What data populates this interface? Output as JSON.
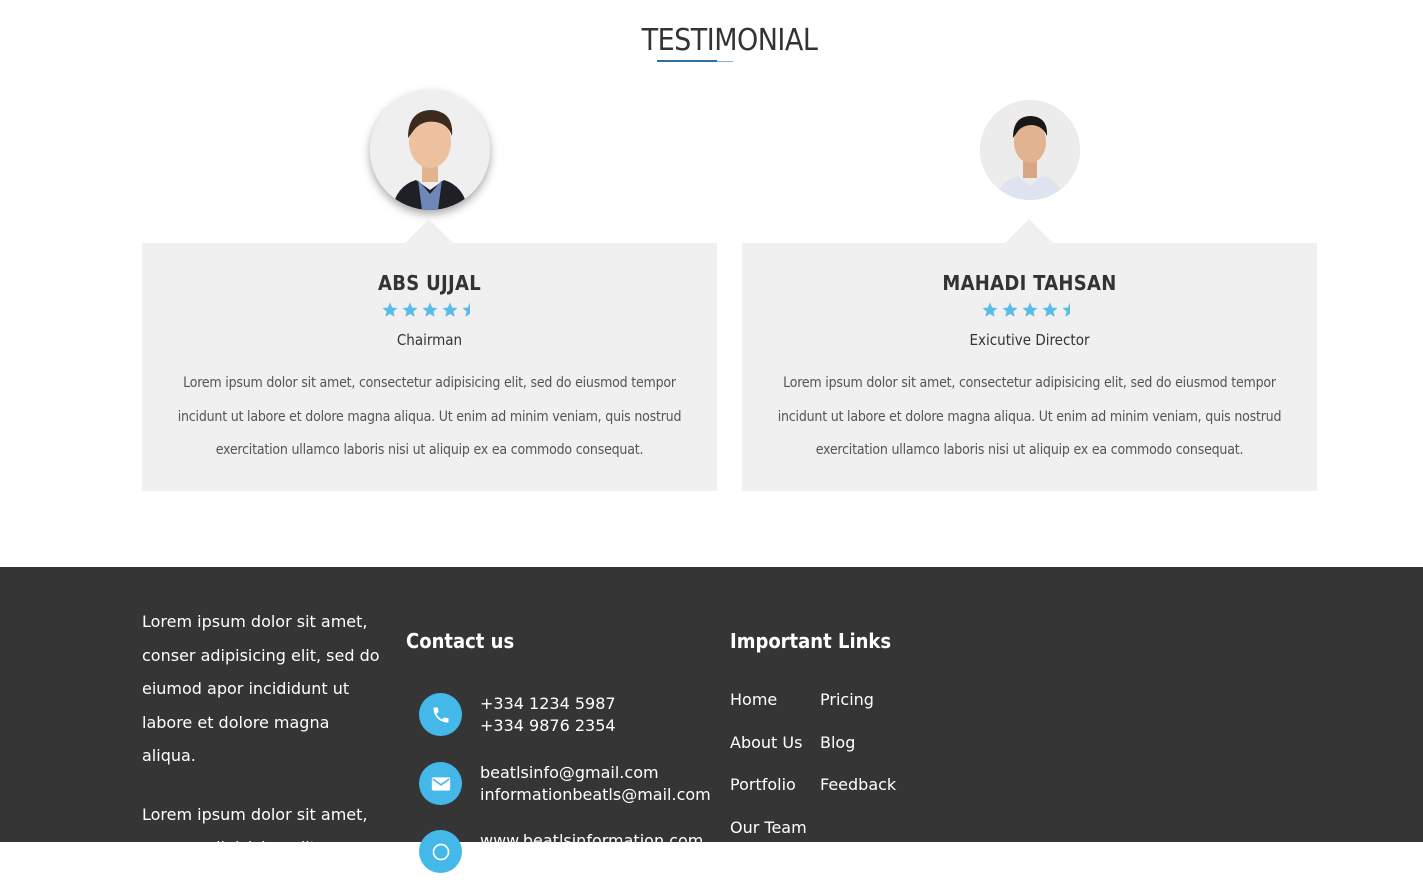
{
  "testimonial": {
    "title": "TESTIMONIAL",
    "cards": [
      {
        "name": "ABS UJJAL",
        "rating": 4.5,
        "role": "Chairman",
        "text": "Lorem ipsum dolor sit amet, consectetur adipisicing elit, sed do eiusmod tempor incidunt ut labore et dolore magna aliqua. Ut enim ad minim veniam, quis nostrud exercitation ullamco laboris nisi ut aliquip ex ea commodo consequat."
      },
      {
        "name": "MAHADI TAHSAN",
        "rating": 4.5,
        "role": "Exicutive Director",
        "text": "Lorem ipsum dolor sit amet, consectetur adipisicing elit, sed do eiusmod tempor incidunt ut labore et dolore magna aliqua. Ut enim ad minim veniam, quis nostrud exercitation ullamco laboris nisi ut aliquip ex ea commodo consequat."
      }
    ],
    "star_color": "#5bbbe9"
  },
  "footer": {
    "about": [
      "Lorem ipsum dolor sit amet, conser adipisicing elit, sed do eiumod apor incididunt ut labore et dolore magna aliqua.",
      "Lorem ipsum dolor sit amet, conser adipisicing elit."
    ],
    "contact": {
      "heading": "Contact us",
      "items": [
        {
          "icon": "phone-icon",
          "lines": [
            "+334 1234 5987",
            "+334 9876 2354"
          ]
        },
        {
          "icon": "envelope-icon",
          "lines": [
            "beatlsinfo@gmail.com",
            "informationbeatls@mail.com"
          ]
        },
        {
          "icon": "globe-icon",
          "lines": [
            "www.beatlsinformation.com"
          ]
        }
      ],
      "icon_color": "#45b8ea"
    },
    "links": {
      "heading": "Important Links",
      "items": [
        "Home",
        "Pricing",
        "About Us",
        "Blog",
        "Portfolio",
        "Feedback",
        "Our Team"
      ]
    },
    "background": "#353535"
  }
}
